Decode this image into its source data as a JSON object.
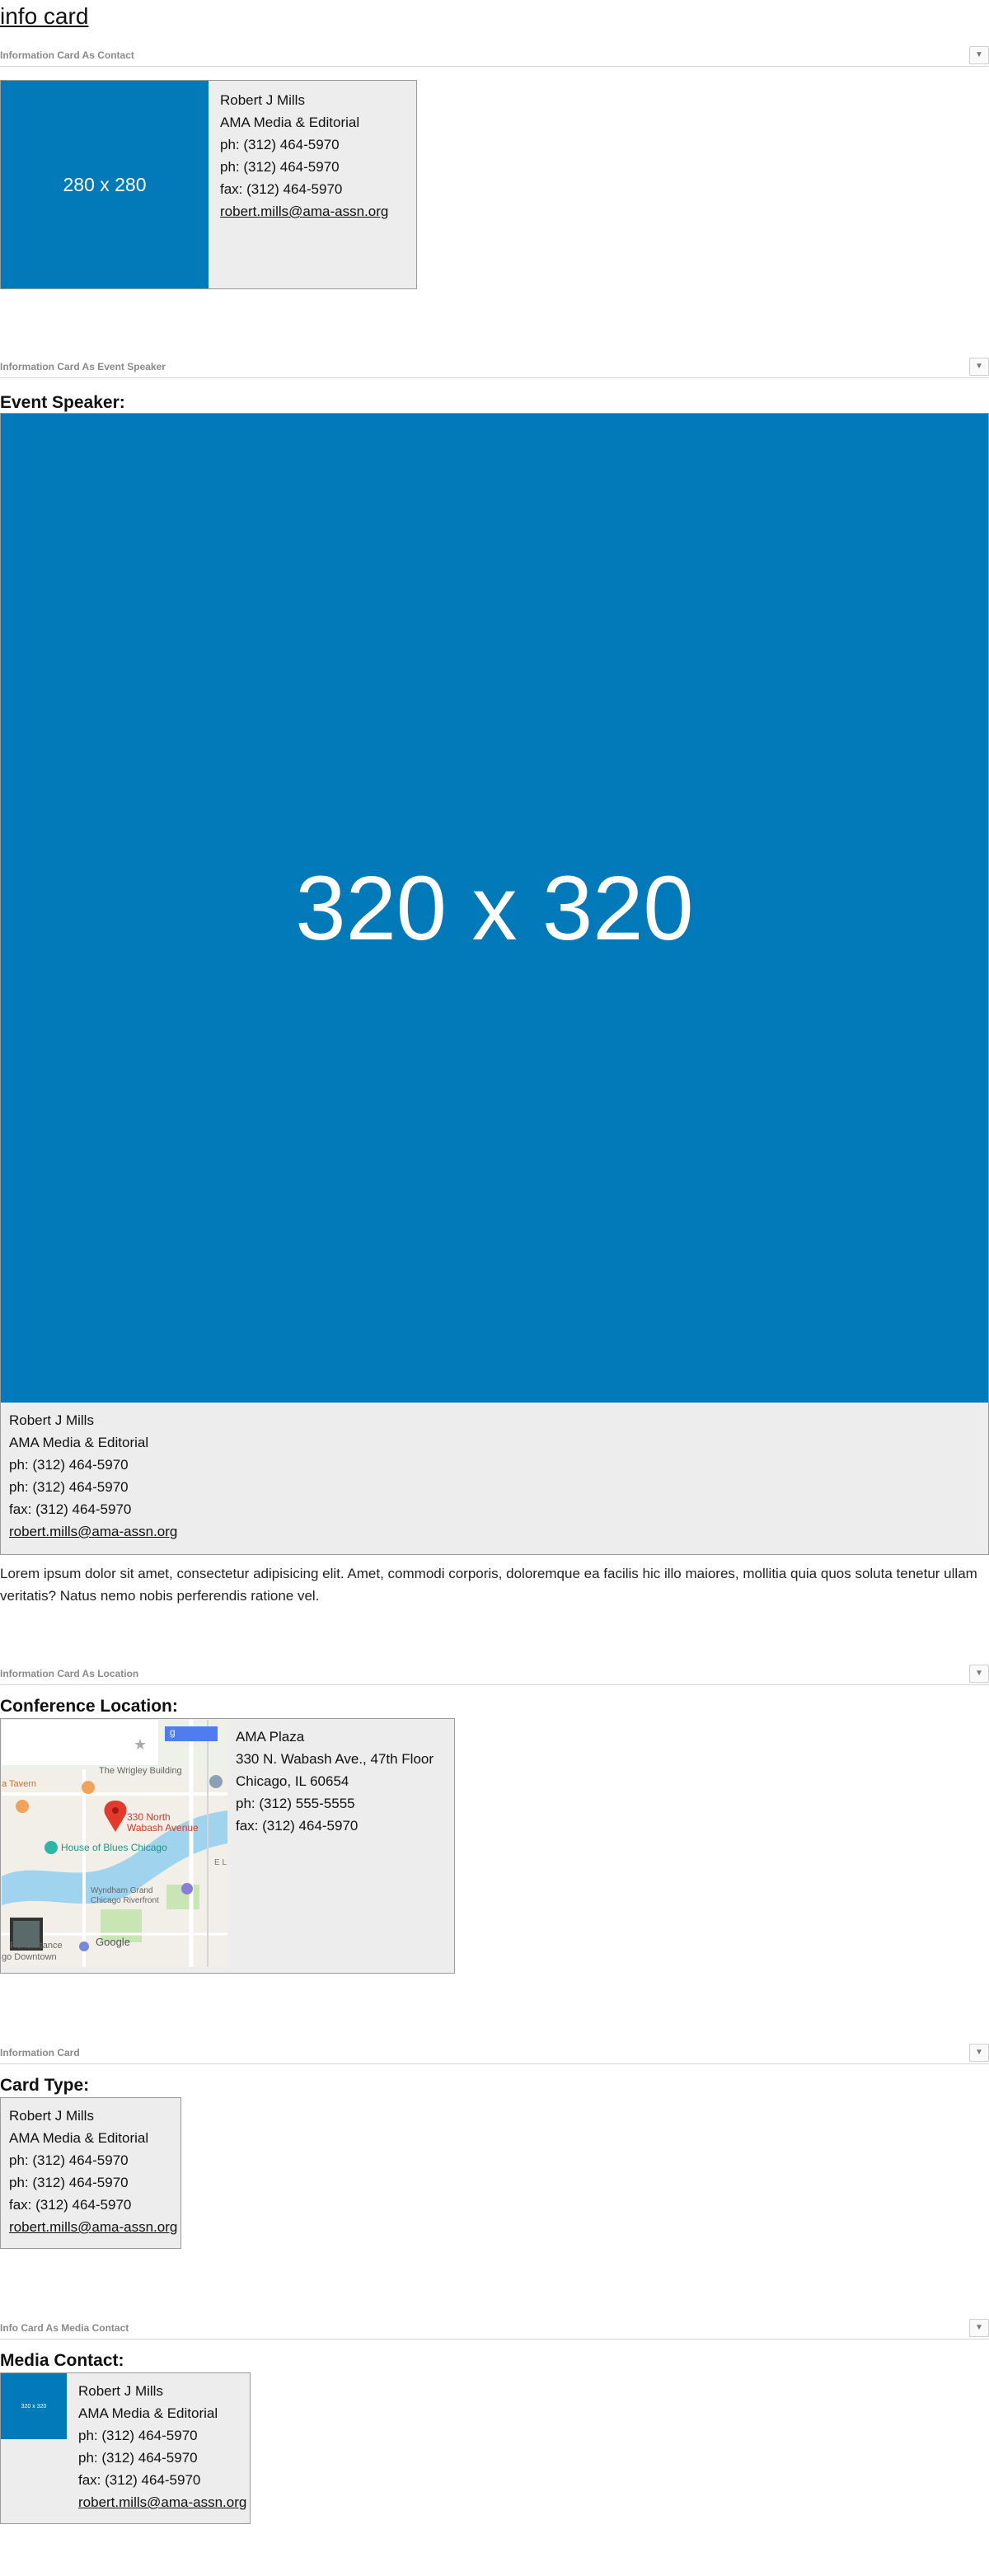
{
  "page": {
    "title": "info card"
  },
  "toggle_glyph": "▼",
  "contact": {
    "name": "Robert J Mills",
    "org": "AMA Media & Editorial",
    "phone1": "ph: (312) 464-5970",
    "phone2": "ph: (312) 464-5970",
    "fax": "fax: (312) 464-5970",
    "email": "robert.mills@ama-assn.org"
  },
  "sections": {
    "contact": {
      "label": "Information Card As Contact",
      "image_text": "280 x 280"
    },
    "event_speaker": {
      "label": "Information Card As Event Speaker",
      "heading": "Event Speaker:",
      "image_text": "320 x 320"
    },
    "location": {
      "label": "Information Card As Location",
      "heading": "Conference Location:",
      "place": "AMA Plaza",
      "street": "330 N. Wabash Ave., 47th Floor",
      "city": "Chicago, IL 60654",
      "phone": "ph: (312) 555-5555",
      "fax": "fax: (312) 464-5970"
    },
    "basic": {
      "label": "Information Card",
      "heading": "Card Type:"
    },
    "media_contact": {
      "label": "Info Card As Media Contact",
      "heading": "Media Contact:",
      "image_text": "320 x 320"
    }
  },
  "lorem": "Lorem ipsum dolor sit amet, consectetur adipisicing elit. Amet, commodi corporis, doloremque ea facilis hic illo maiores, mollitia quia quos soluta tenetur ullam veritatis? Natus nemo nobis perferendis ratione vel.",
  "map": {
    "pin_label_1": "330 North",
    "pin_label_2": "Wabash Avenue",
    "poi_wrigley": "The Wrigley Building",
    "poi_tavern": "a Tavern",
    "poi_hob": "House of Blues Chicago",
    "poi_wyndham_1": "Wyndham Grand",
    "poi_wyndham_2": "Chicago Riverfront",
    "poi_renaissance": "Renaissance",
    "poi_downtown": "go Downtown",
    "google": "Google",
    "el_label": "E L",
    "search_glyph": "g"
  }
}
